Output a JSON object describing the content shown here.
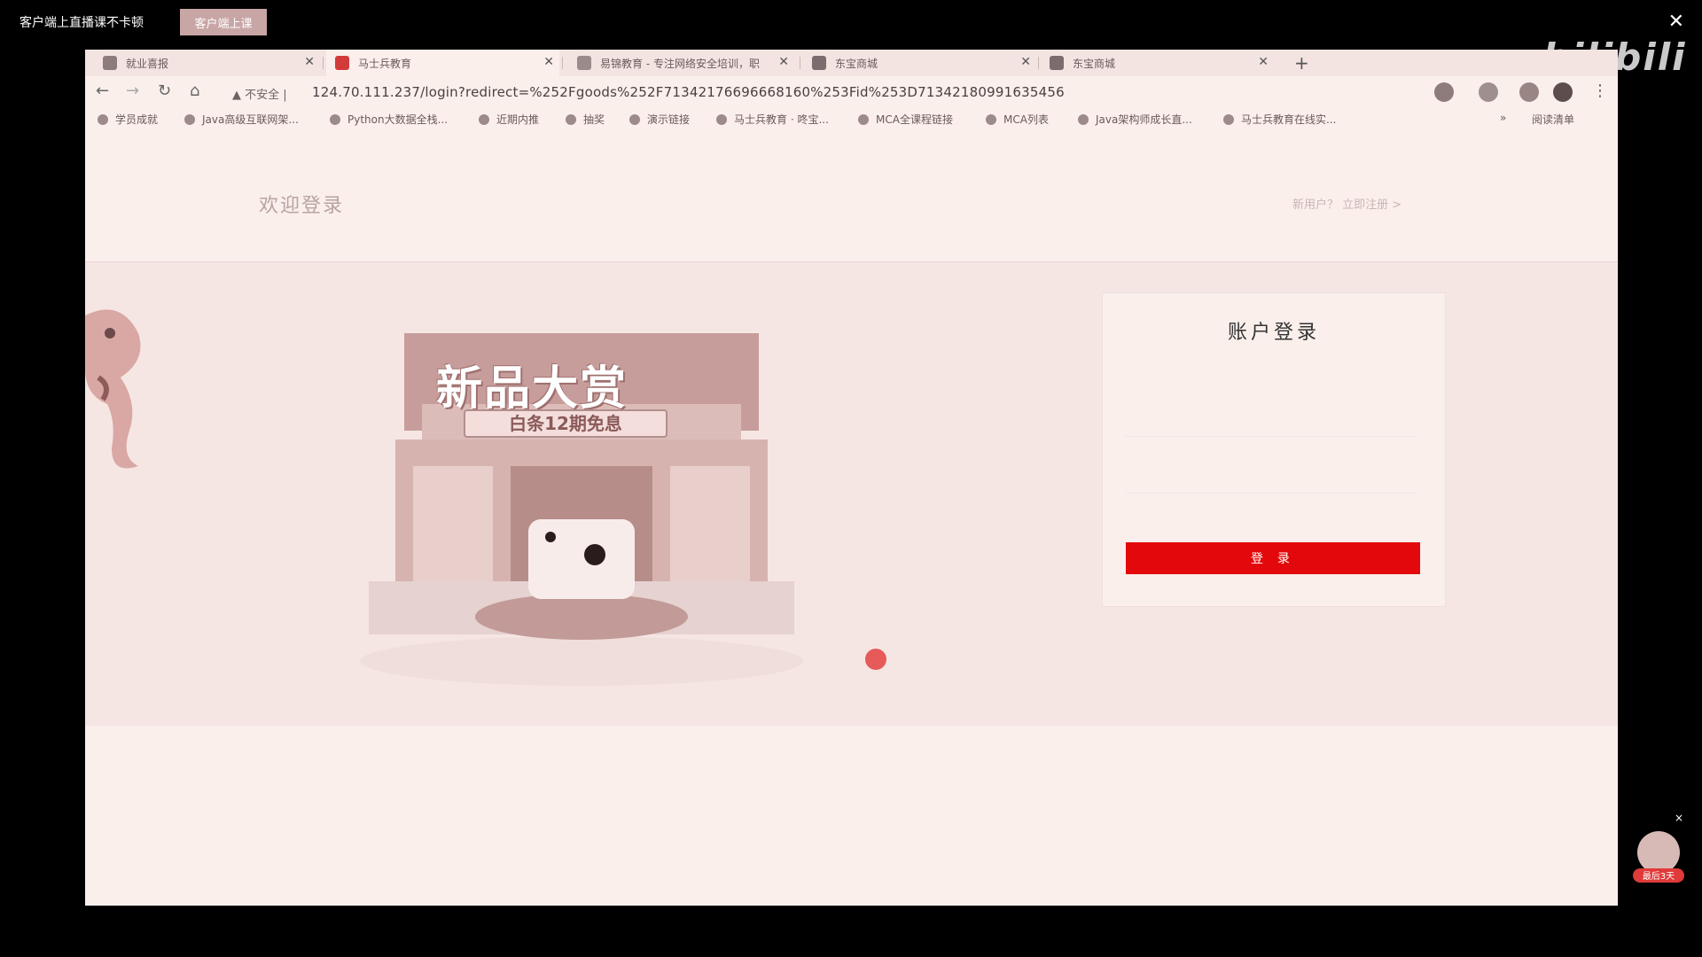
{
  "player": {
    "title": "客户端上直播课不卡顿",
    "button_label": "客户端上课",
    "close_glyph": "✕",
    "logo_text": "bilibili"
  },
  "tabs": [
    {
      "label": "就业喜报",
      "favicon_color": "#8e7b7b",
      "close": "✕"
    },
    {
      "label": "马士兵教育",
      "favicon_color": "#d33b3b",
      "close": "✕"
    },
    {
      "label": "易锦教育 - 专注网络安全培训，职",
      "favicon_color": "#9c8b8b",
      "close": "✕"
    },
    {
      "label": "东宝商城",
      "favicon_color": "#7b6d6d",
      "close": "✕"
    },
    {
      "label": "东宝商城",
      "favicon_color": "#7b6d6d",
      "close": "✕"
    }
  ],
  "new_tab": "+",
  "toolbar": {
    "back": "←",
    "forward": "→",
    "reload": "↻",
    "home": "⌂",
    "security_label": "▲ 不安全 |",
    "url": "124.70.111.237/login?redirect=%252Fgoods%252F71342176696668160%253Fid%253D71342180991635456",
    "menu": "⋮"
  },
  "bookmarks": [
    "学员成就",
    "Java高级互联网架...",
    "Python大数据全栈...",
    "近期内推",
    "抽奖",
    "演示链接",
    "马士兵教育 · 咚宝...",
    "MCA全课程链接",
    "MCA列表",
    "Java架构师成长直...",
    "马士兵教育在线实..."
  ],
  "bookmarks_more": "»",
  "reading_list": "阅读清单",
  "page": {
    "welcome": "欢迎登录",
    "register_prompt": "新用户？ 立即注册 >"
  },
  "promo": {
    "title": "新品大赏",
    "subtitle": "白条12期免息"
  },
  "login": {
    "title": "账户登录",
    "username_placeholder": "",
    "password_placeholder": "",
    "submit": "登 录"
  },
  "corner_badge": {
    "label": "最后3天",
    "close": "×"
  },
  "colors": {
    "primary_button": "#e3080c",
    "page_bg": "#fbefec"
  }
}
